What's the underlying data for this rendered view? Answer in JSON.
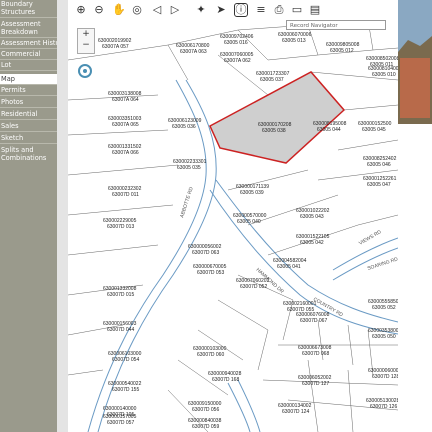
{
  "sidebar": {
    "items": [
      {
        "label": "Boundary",
        "active": false
      },
      {
        "label": "Structures",
        "active": false
      },
      {
        "label": "Assessment",
        "active": false
      },
      {
        "label": "Breakdown",
        "active": false
      },
      {
        "label": "Assessment History",
        "active": false
      },
      {
        "label": "Commercial",
        "active": false
      },
      {
        "label": "Lot",
        "active": false
      },
      {
        "label": "Map",
        "active": true
      },
      {
        "label": "Permits",
        "active": false
      },
      {
        "label": "Photos",
        "active": false
      },
      {
        "label": "Residential",
        "active": false
      },
      {
        "label": "Sales",
        "active": false
      },
      {
        "label": "Sketch",
        "active": false
      },
      {
        "label": "Splits and",
        "active": false
      },
      {
        "label": "Combinations",
        "active": false
      }
    ]
  },
  "toolbar": {
    "icons": [
      "zoom-in",
      "zoom-out",
      "pan",
      "full-extent",
      "back",
      "forward",
      "identify",
      "select",
      "info",
      "layers",
      "print",
      "measure",
      "basemap"
    ],
    "record_nav_placeholder": "Record Navigator"
  },
  "map": {
    "zoom_plus": "+",
    "zoom_minus": "−",
    "colors": {
      "road": "#6a9ac4",
      "parcel_line": "#666666",
      "highlight_fill": "#cfcfcf",
      "highlight_border": "#cc2222"
    },
    "streets": [
      "ABBOTTE RD",
      "HAMMOND DR",
      "COUNTRY RD",
      "SOARING RD",
      "VIEWS RD"
    ],
    "parcels": [
      {
        "id": "630002019902",
        "sub": "63007A 057"
      },
      {
        "id": "630009702406",
        "sub": "63005 016"
      },
      {
        "id": "630006070006",
        "sub": "63005 013"
      },
      {
        "id": "630009805008",
        "sub": "63005 012"
      },
      {
        "id": "630008502008",
        "sub": "63005 011"
      },
      {
        "id": "630008104003",
        "sub": "63005 010"
      },
      {
        "id": "630006170800",
        "sub": "63007A 063"
      },
      {
        "id": "630007060005",
        "sub": "63007A 062"
      },
      {
        "id": "630001723307",
        "sub": "63005 037"
      },
      {
        "id": "630003138008",
        "sub": "63007A 064"
      },
      {
        "id": "630003351003",
        "sub": "63007A 065"
      },
      {
        "id": "630006123009",
        "sub": "63005 036"
      },
      {
        "id": "630000170208",
        "sub": "63005 038"
      },
      {
        "id": "630008195008",
        "sub": "63005 044"
      },
      {
        "id": "630000152500",
        "sub": "63005 045"
      },
      {
        "id": "630001331502",
        "sub": "63007A 066"
      },
      {
        "id": "630002233301",
        "sub": "63005 035"
      },
      {
        "id": "630008252402",
        "sub": "63005 046"
      },
      {
        "id": "630001252261",
        "sub": "63005 047"
      },
      {
        "id": "630000232302",
        "sub": "63007D 011"
      },
      {
        "id": "630000171139",
        "sub": "63005 039"
      },
      {
        "id": "630001022202",
        "sub": "63005 043"
      },
      {
        "id": "630002229005",
        "sub": "63007D 013"
      },
      {
        "id": "630000570000",
        "sub": "63005 040"
      },
      {
        "id": "630001522105",
        "sub": "63005 042"
      },
      {
        "id": "630000056002",
        "sub": "63007D 063"
      },
      {
        "id": "630004582004",
        "sub": "63005 041"
      },
      {
        "id": "630001332008",
        "sub": "63007D 015"
      },
      {
        "id": "630000670005",
        "sub": "63007D 053"
      },
      {
        "id": "630007060202",
        "sub": "63007D 052"
      },
      {
        "id": "630002160001",
        "sub": "63007D 055"
      },
      {
        "id": "630005558501",
        "sub": "63005 052"
      },
      {
        "id": "630000156003",
        "sub": "63007D 044"
      },
      {
        "id": "630006076008",
        "sub": "63007D 067"
      },
      {
        "id": "630003538008",
        "sub": "63005 050"
      },
      {
        "id": "630006103000",
        "sub": "63007D 054"
      },
      {
        "id": "630000103000",
        "sub": "63007D 060"
      },
      {
        "id": "630006673008",
        "sub": "63007D 068"
      },
      {
        "id": "630000060000",
        "sub": "63007D 128"
      },
      {
        "id": "630000540022",
        "sub": "63007D 155"
      },
      {
        "id": "630000940028",
        "sub": "63007D 168"
      },
      {
        "id": "630006052002",
        "sub": "63007D 127"
      },
      {
        "id": "630005130028",
        "sub": "63007D 126"
      },
      {
        "id": "630009150000",
        "sub": "63007D 056"
      },
      {
        "id": "630000140000",
        "sub": "63007D 105"
      },
      {
        "id": "630000134002",
        "sub": "63007D 124"
      },
      {
        "id": "630000157005",
        "sub": "63007D 057"
      },
      {
        "id": "630000840038",
        "sub": "63007D 059"
      }
    ]
  },
  "photo": {
    "sky": "#8aa8c2",
    "hill": "#7a6a4e",
    "building": "#b86a4a"
  }
}
